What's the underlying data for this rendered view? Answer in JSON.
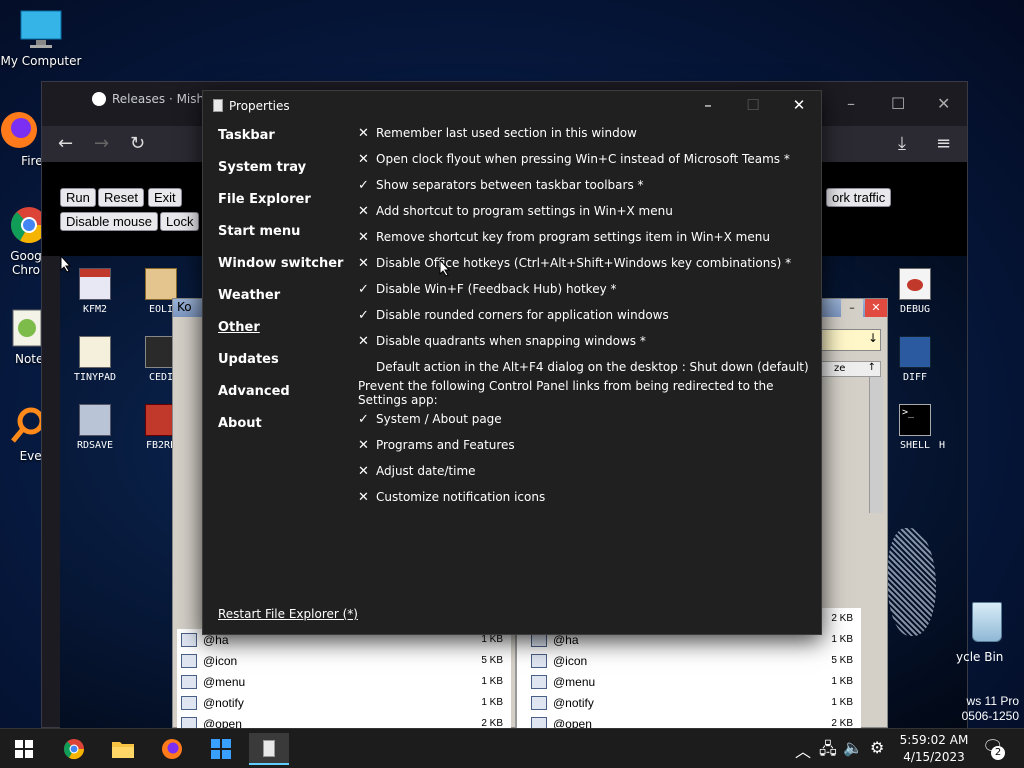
{
  "desktop": {
    "icons": [
      {
        "label": "My Computer"
      },
      {
        "label": "Firef"
      },
      {
        "label": "Goog Chro"
      },
      {
        "label": "Notep"
      },
      {
        "label": "Everyt"
      }
    ],
    "recycle_label": "ycle Bin",
    "watermark_line1": "ws 11 Pro",
    "watermark_line2": "0506-1250"
  },
  "browser": {
    "tab_title": "Releases · Misha",
    "page_buttons": [
      "Run",
      "Reset",
      "Exit",
      "Disable mouse",
      "Lock"
    ],
    "network_button": "ork traffic",
    "inner_icons": [
      {
        "label": "KFM2"
      },
      {
        "label": "EOLI"
      },
      {
        "label": "TINYPAD"
      },
      {
        "label": "CEDI"
      },
      {
        "label": "RDSAVE"
      },
      {
        "label": "FB2RE"
      },
      {
        "label": "DEBUG"
      },
      {
        "label": "DIFF"
      },
      {
        "label": "SHELL"
      },
      {
        "label": "H"
      }
    ]
  },
  "file_manager": {
    "title_fragment": "Ko",
    "size_header": "ze",
    "left_rows": [
      {
        "name": "@ha",
        "size": "1 KB"
      },
      {
        "name": "@icon",
        "size": "5 KB"
      },
      {
        "name": "@menu",
        "size": "1 KB"
      },
      {
        "name": "@notify",
        "size": "1 KB"
      },
      {
        "name": "@open",
        "size": "2 KB"
      }
    ],
    "right_rows": [
      {
        "name": "",
        "size": "2 KB"
      },
      {
        "name": "@ha",
        "size": "1 KB"
      },
      {
        "name": "@icon",
        "size": "5 KB"
      },
      {
        "name": "@menu",
        "size": "1 KB"
      },
      {
        "name": "@notify",
        "size": "1 KB"
      },
      {
        "name": "@open",
        "size": "2 KB"
      }
    ]
  },
  "properties": {
    "title": "Properties",
    "nav": [
      {
        "label": "Taskbar",
        "active": false
      },
      {
        "label": "System tray",
        "active": false
      },
      {
        "label": "File Explorer",
        "active": false
      },
      {
        "label": "Start menu",
        "active": false
      },
      {
        "label": "Window switcher",
        "active": false
      },
      {
        "label": "Weather",
        "active": false
      },
      {
        "label": "Other",
        "active": true
      },
      {
        "label": "Updates",
        "active": false
      },
      {
        "label": "Advanced",
        "active": false
      },
      {
        "label": "About",
        "active": false
      }
    ],
    "options": [
      {
        "mark": "✕",
        "text": "Remember last used section in this window"
      },
      {
        "mark": "✕",
        "text": "Open clock flyout when pressing Win+C instead of Microsoft Teams *"
      },
      {
        "mark": "✓",
        "text": "Show separators between taskbar toolbars *"
      },
      {
        "mark": "✕",
        "text": "Add shortcut to program settings in Win+X menu"
      },
      {
        "mark": "✕",
        "text": "Remove shortcut key from program settings item in Win+X menu"
      },
      {
        "mark": "✕",
        "text": "Disable Office hotkeys (Ctrl+Alt+Shift+Windows key combinations) *"
      },
      {
        "mark": "✓",
        "text": "Disable Win+F (Feedback Hub) hotkey *"
      },
      {
        "mark": "✓",
        "text": "Disable rounded corners for application windows"
      },
      {
        "mark": "✕",
        "text": "Disable quadrants when snapping windows *"
      },
      {
        "mark": "",
        "text": "Default action in the Alt+F4 dialog on the desktop : Shut down (default)"
      },
      {
        "mark": "none",
        "text": "Prevent the following Control Panel links from being redirected to the Settings app:"
      },
      {
        "mark": "✓",
        "text": "System / About page"
      },
      {
        "mark": "✕",
        "text": "Programs and Features"
      },
      {
        "mark": "✕",
        "text": "Adjust date/time"
      },
      {
        "mark": "✕",
        "text": "Customize notification icons"
      }
    ],
    "restart_link": "Restart File Explorer (*)"
  },
  "taskbar": {
    "time": "5:59:02 AM",
    "date": "4/15/2023",
    "notification_count": "2"
  },
  "colors": {
    "dialog_bg": "#202020",
    "taskbar_bg": "#1c1c1c",
    "accent": "#60cdff"
  }
}
